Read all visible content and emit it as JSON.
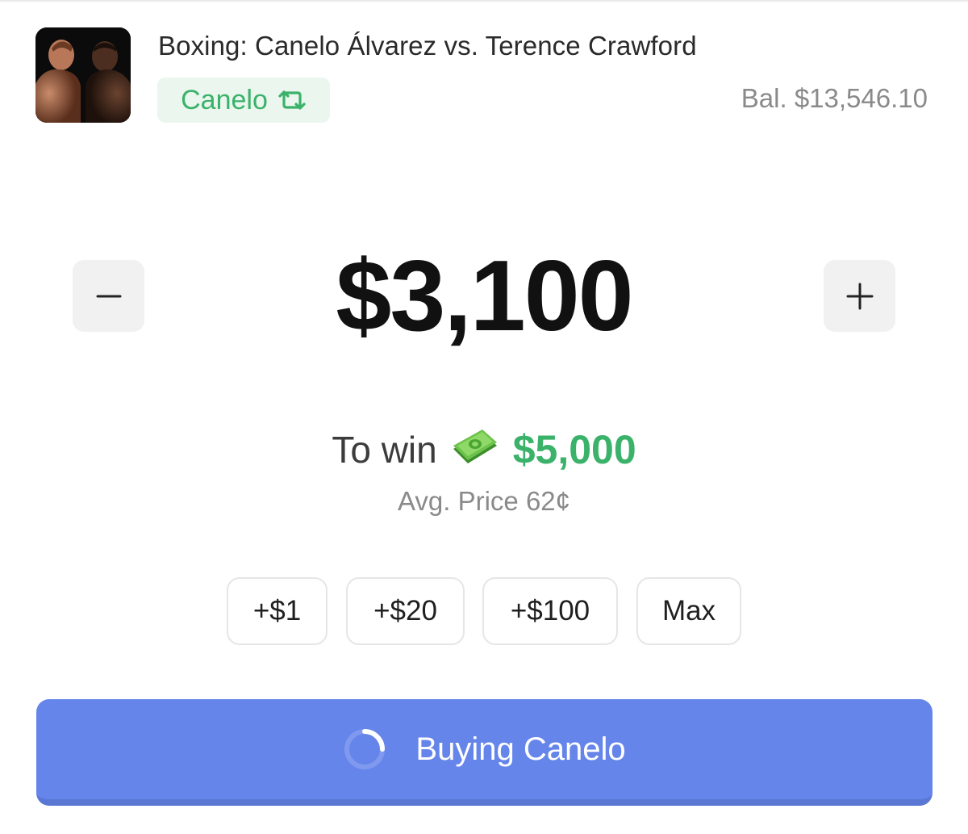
{
  "header": {
    "market_title": "Boxing: Canelo Álvarez vs. Terence Crawford",
    "outcome_label": "Canelo",
    "balance": "Bal. $13,546.10"
  },
  "order": {
    "amount": "$3,100",
    "to_win_label": "To win",
    "to_win_value": "$5,000",
    "avg_price": "Avg. Price 62¢"
  },
  "quick_add": [
    {
      "label": "+$1"
    },
    {
      "label": "+$20"
    },
    {
      "label": "+$100"
    },
    {
      "label": "Max"
    }
  ],
  "action": {
    "button_label": "Buying Canelo"
  },
  "icons": {
    "swap": "swap-arrows-icon",
    "minus": "minus-icon",
    "plus": "plus-icon",
    "money": "money-bill-icon",
    "spinner": "loading-spinner-icon"
  },
  "colors": {
    "accent_green": "#3bb26a",
    "pill_bg": "#eaf6ee",
    "button_blue": "#6585ea",
    "step_bg": "#f1f1f1"
  }
}
